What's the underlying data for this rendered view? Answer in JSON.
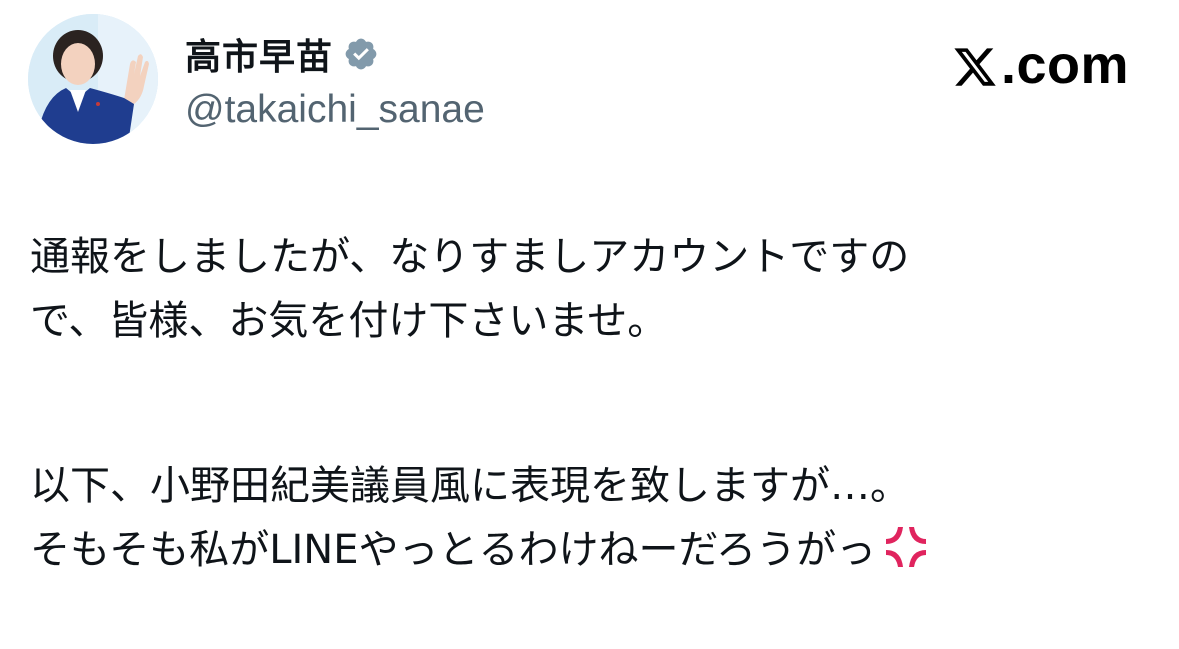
{
  "author": {
    "display_name": "高市早苗",
    "handle": "@takaichi_sanae",
    "verified_icon": "verified-badge-icon",
    "avatar_icon": "avatar"
  },
  "brand": {
    "logo_icon": "x-logo-icon",
    "suffix": ".com"
  },
  "post": {
    "paragraph1": {
      "line1": "通報をしましたが、なりすましアカウントですの",
      "line2": "で、皆様、お気を付け下さいませ。"
    },
    "paragraph2": {
      "line1": "以下、小野田紀美議員風に表現を致しますが…。",
      "line2": "そもそも私がLINEやっとるわけねーだろうがっ"
    },
    "emoji_icon": "anger-symbol-icon"
  },
  "colors": {
    "text_primary": "#0f1419",
    "text_secondary": "#536471",
    "verified_badge": "#829aab",
    "anger_symbol": "#e0245e"
  }
}
